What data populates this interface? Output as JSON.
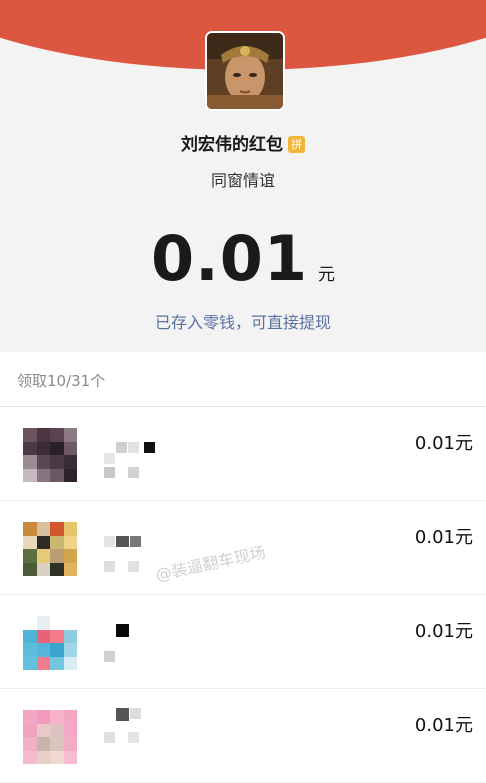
{
  "header": {
    "sender_title": "刘宏伟的红包",
    "pin_badge": "拼",
    "blessing": "同窗情谊",
    "amount": "0.01",
    "amount_unit": "元",
    "saved_notice": "已存入零钱，可直接提现"
  },
  "summary": {
    "received_count": "领取10/31个"
  },
  "recipients": [
    {
      "amount": "0.01元"
    },
    {
      "amount": "0.01元"
    },
    {
      "amount": "0.01元"
    },
    {
      "amount": "0.01元"
    }
  ],
  "watermark": "@装逼翻车现场",
  "colors": {
    "red_arc": "#dd5640",
    "link_blue": "#5a72a3",
    "badge_gold": "#f0b73b",
    "background": "#f3f3f3"
  }
}
